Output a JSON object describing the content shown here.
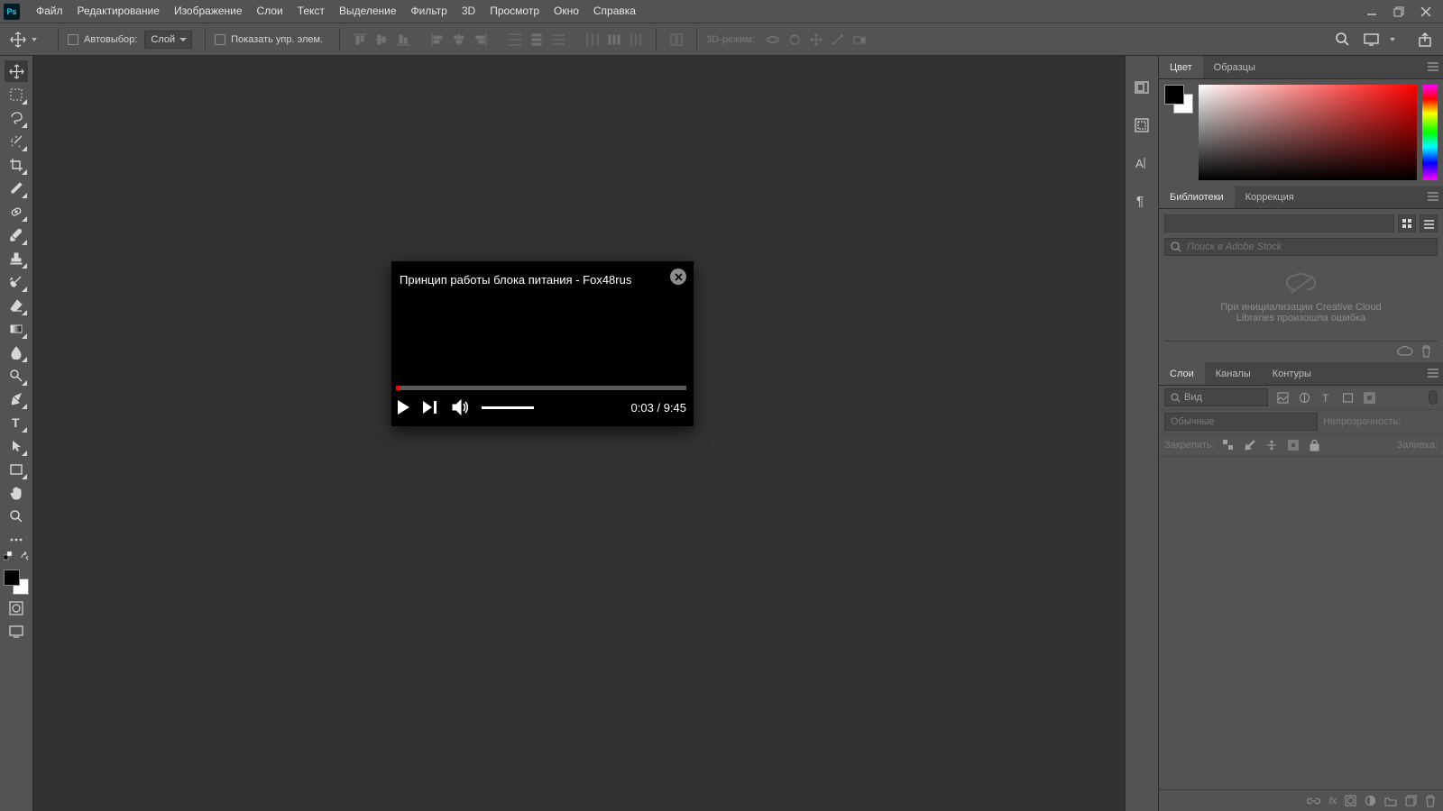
{
  "menu": [
    "Файл",
    "Редактирование",
    "Изображение",
    "Слои",
    "Текст",
    "Выделение",
    "Фильтр",
    "3D",
    "Просмотр",
    "Окно",
    "Справка"
  ],
  "options": {
    "auto_select": "Автовыбор:",
    "target": "Слой",
    "show_controls": "Показать упр. элем.",
    "mode3d": "3D-режим:"
  },
  "video": {
    "title": "Принцип работы блока питания - Fox48rus",
    "elapsed": "0:03",
    "total": "9:45"
  },
  "panels": {
    "color_tabs": [
      "Цвет",
      "Образцы"
    ],
    "lib_tabs": [
      "Библиотеки",
      "Коррекция"
    ],
    "lib_search_placeholder": "Поиск в Adobe Stock",
    "lib_error": "При инициализации Creative Cloud Libraries произошла ошибка",
    "layer_tabs": [
      "Слои",
      "Каналы",
      "Контуры"
    ],
    "kind": "Вид",
    "blend": "Обычные",
    "opacity": "Непрозрачность:",
    "lock": "Закрепить:",
    "fill": "Заливка:"
  }
}
